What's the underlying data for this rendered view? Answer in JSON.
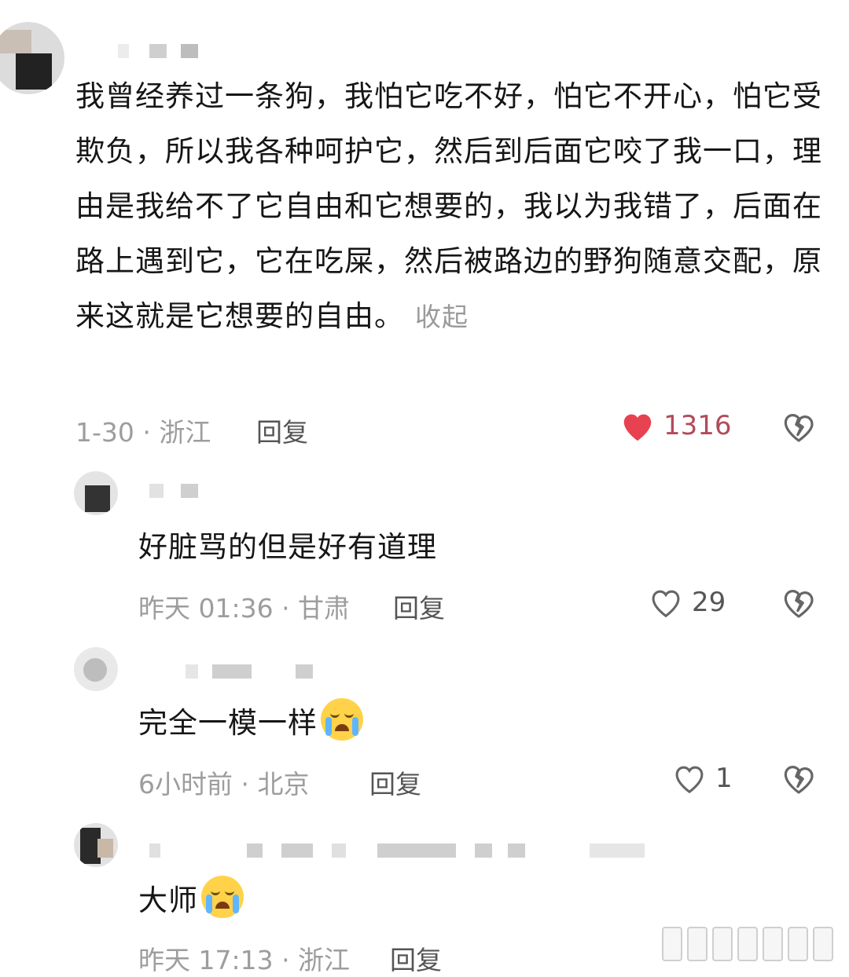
{
  "comments": [
    {
      "text": "我曾经养过一条狗，我怕它吃不好，怕它不开心，怕它受欺负，所以我各种呵护它，然后到后面它咬了我一口，理由是我给不了它自由和它想要的，我以为我错了，后面在路上遇到它，它在吃屎，然后被路边的野狗随意交配，原来这就是它想要的自由。",
      "collapse_label": "收起",
      "meta": "1-30 · 浙江",
      "reply_label": "回复",
      "likes": "1316",
      "liked": true
    },
    {
      "text": "好脏骂的但是好有道理",
      "meta": "昨天 01:36 · 甘肃",
      "reply_label": "回复",
      "likes": "29",
      "liked": false
    },
    {
      "text": "完全一模一样",
      "emoji": "crying-laugh-emoji",
      "meta": "6小时前 · 北京",
      "reply_label": "回复",
      "likes": "1",
      "liked": false
    },
    {
      "text": "大师",
      "emoji": "crying-emoji",
      "meta": "昨天 17:13 · 浙江",
      "reply_label": "回复"
    }
  ],
  "colors": {
    "liked_heart": "#e8414f",
    "liked_count": "#b24a5a",
    "meta_text": "#9d9d9d",
    "icon_gray": "#666666"
  }
}
